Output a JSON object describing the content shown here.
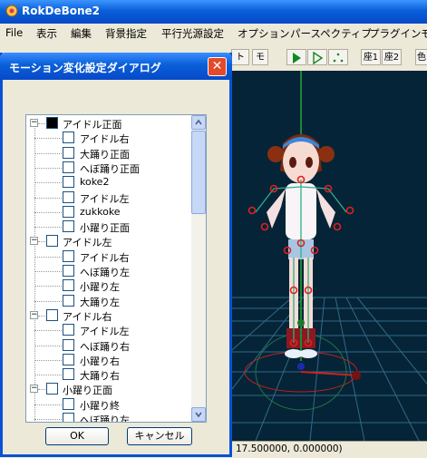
{
  "app": {
    "title": "RokDeBone2"
  },
  "menu": [
    "File",
    "表示",
    "編集",
    "背景指定",
    "平行光源設定",
    "オプション",
    "パースペクティブ",
    "プラグイン",
    "モ"
  ],
  "toolbar": {
    "btn_to": "ト",
    "btn_mo": "モ",
    "coord1": "座1",
    "coord2": "座2",
    "btn_color": "色"
  },
  "dialog": {
    "title": "モーション変化設定ダイアログ",
    "ok_label": "OK",
    "cancel_label": "キャンセル",
    "tree": [
      {
        "label": "アイドル正面",
        "level": 0,
        "checked": true
      },
      {
        "label": "アイドル右",
        "level": 1,
        "checked": false
      },
      {
        "label": "大踊り正面",
        "level": 1,
        "checked": false
      },
      {
        "label": "へぼ踊り正面",
        "level": 1,
        "checked": false
      },
      {
        "label": "koke2",
        "level": 1,
        "checked": false
      },
      {
        "label": "アイドル左",
        "level": 1,
        "checked": false
      },
      {
        "label": "zukkoke",
        "level": 1,
        "checked": false
      },
      {
        "label": "小躍り正面",
        "level": 1,
        "checked": false
      },
      {
        "label": "アイドル左",
        "level": 0,
        "checked": false
      },
      {
        "label": "アイドル右",
        "level": 1,
        "checked": false
      },
      {
        "label": "へぼ踊り左",
        "level": 1,
        "checked": false
      },
      {
        "label": "小躍り左",
        "level": 1,
        "checked": false
      },
      {
        "label": "大踊り左",
        "level": 1,
        "checked": false
      },
      {
        "label": "アイドル右",
        "level": 0,
        "checked": false
      },
      {
        "label": "アイドル左",
        "level": 1,
        "checked": false
      },
      {
        "label": "へぼ踊り右",
        "level": 1,
        "checked": false
      },
      {
        "label": "小躍り右",
        "level": 1,
        "checked": false
      },
      {
        "label": "大踊り右",
        "level": 1,
        "checked": false
      },
      {
        "label": "小躍り正面",
        "level": 0,
        "checked": false
      },
      {
        "label": "小躍り終",
        "level": 1,
        "checked": false
      },
      {
        "label": "へぼ踊り左",
        "level": 1,
        "checked": false
      }
    ]
  },
  "status": {
    "coords": "17.500000, 0.000000)"
  },
  "colors": {
    "titlebar": "#0a5fd8",
    "viewport_bg": "#062437",
    "grid": "#2f6a8a",
    "bone_joint": "#e02020"
  }
}
